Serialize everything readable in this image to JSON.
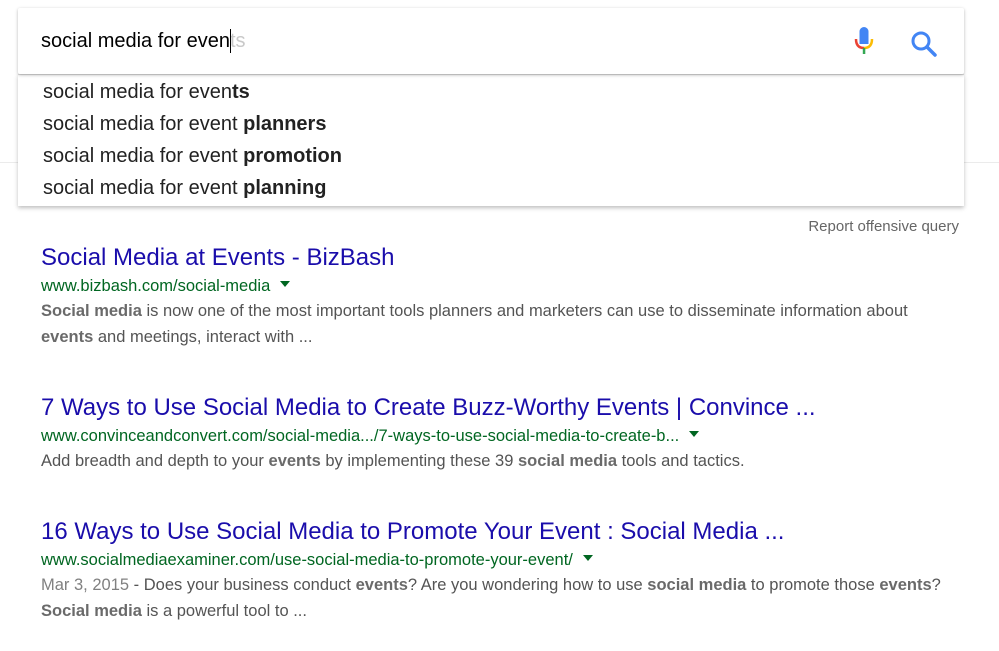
{
  "search": {
    "typed": "social media for even",
    "ghost": "ts"
  },
  "suggestions": [
    {
      "prefix": "social media for even",
      "bold": "ts"
    },
    {
      "prefix": "social media for event",
      "bold": " planners"
    },
    {
      "prefix": "social media for event",
      "bold": " promotion"
    },
    {
      "prefix": "social media for event",
      "bold": " planning"
    }
  ],
  "report_label": "Report offensive query",
  "results": [
    {
      "title": "Social Media at Events - BizBash",
      "url": "www.bizbash.com/social-media",
      "date": "",
      "snippet": [
        {
          "t": "Social media",
          "b": true
        },
        {
          "t": " is now one of the most important tools planners and marketers can use to disseminate information about ",
          "b": false
        },
        {
          "t": "events",
          "b": true
        },
        {
          "t": " and meetings, interact with ...",
          "b": false
        }
      ]
    },
    {
      "title": "7 Ways to Use Social Media to Create Buzz-Worthy Events | Convince ...",
      "url": "www.convinceandconvert.com/social-media.../7-ways-to-use-social-media-to-create-b...",
      "date": "",
      "snippet": [
        {
          "t": "Add breadth and depth to your ",
          "b": false
        },
        {
          "t": "events",
          "b": true
        },
        {
          "t": " by implementing these 39 ",
          "b": false
        },
        {
          "t": "social media",
          "b": true
        },
        {
          "t": " tools and tactics.",
          "b": false
        }
      ]
    },
    {
      "title": "16 Ways to Use Social Media to Promote Your Event : Social Media ...",
      "url": "www.socialmediaexaminer.com/use-social-media-to-promote-your-event/",
      "date": "Mar 3, 2015",
      "snippet": [
        {
          "t": " - Does your business conduct ",
          "b": false
        },
        {
          "t": "events",
          "b": true
        },
        {
          "t": "? Are you wondering how to use ",
          "b": false
        },
        {
          "t": "social media",
          "b": true
        },
        {
          "t": " to promote those ",
          "b": false
        },
        {
          "t": "events",
          "b": true
        },
        {
          "t": "? ",
          "b": false
        },
        {
          "t": "Social media",
          "b": true
        },
        {
          "t": " is a powerful tool to ...",
          "b": false
        }
      ]
    }
  ],
  "colors": {
    "link": "#1a0dab",
    "url": "#006621",
    "snippet": "#545454",
    "search_icon": "#4285f4"
  },
  "icons": [
    "microphone-icon",
    "search-icon",
    "dropdown-arrow-icon"
  ]
}
